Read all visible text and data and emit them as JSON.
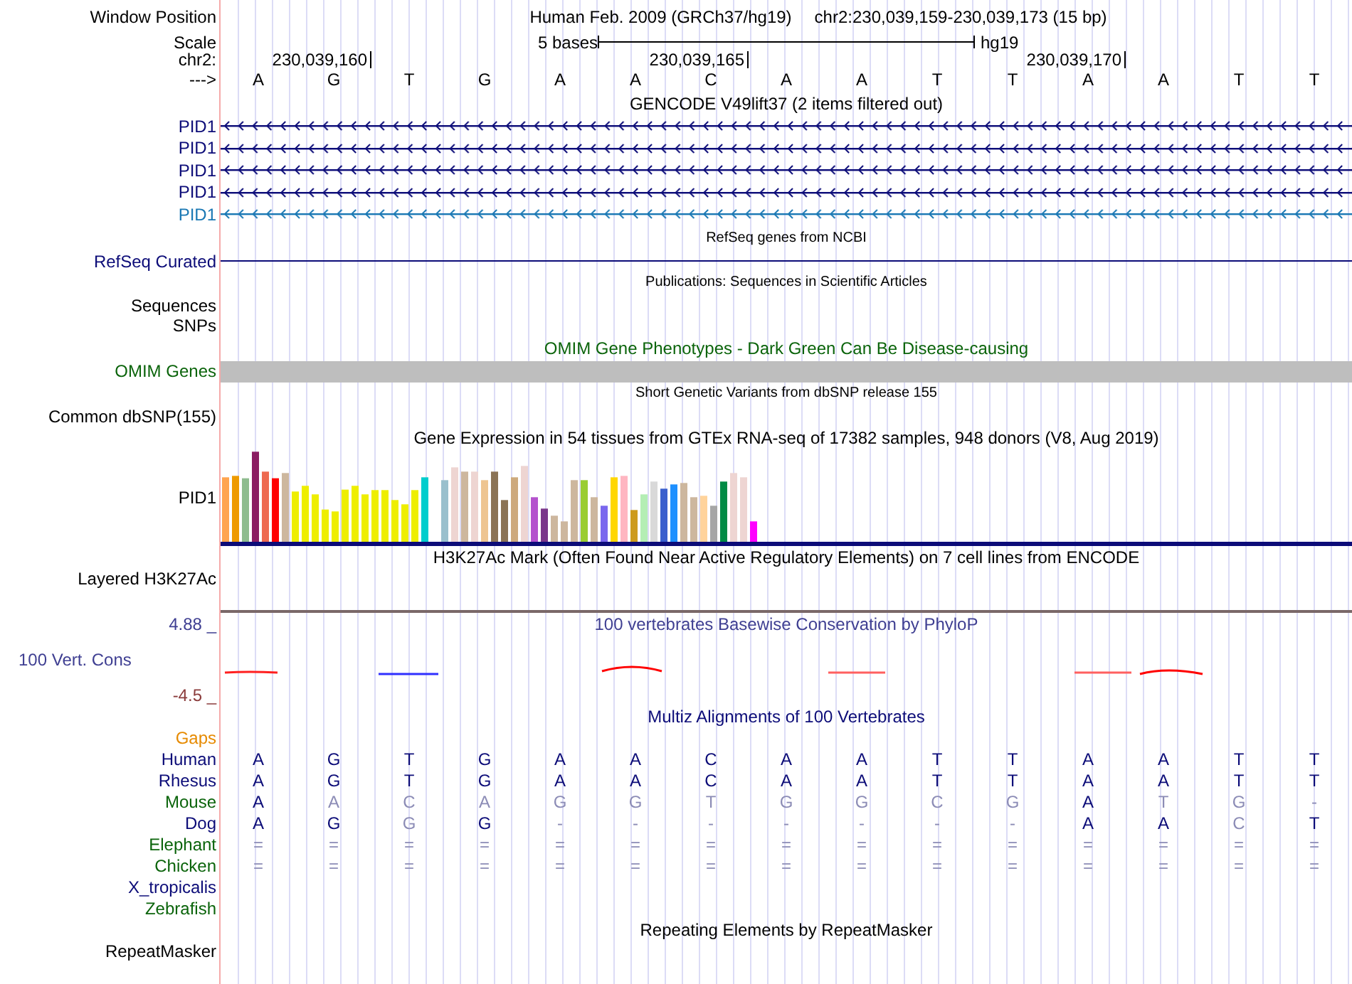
{
  "header": {
    "window_position": {
      "label": "Window Position",
      "assembly": "Human Feb. 2009 (GRCh37/hg19)",
      "region": "chr2:230,039,159-230,039,173 (15 bp)"
    },
    "scale": {
      "label": "Scale",
      "length": "5 bases",
      "assembly": "hg19"
    },
    "ruler_label": "chr2:",
    "strand_label": "--->"
  },
  "sequence": [
    {
      "base": "A"
    },
    {
      "base": "G",
      "coordinate": "230,039,160"
    },
    {
      "base": "T"
    },
    {
      "base": "G"
    },
    {
      "base": "A"
    },
    {
      "base": "A"
    },
    {
      "base": "C",
      "coordinate": "230,039,165"
    },
    {
      "base": "A"
    },
    {
      "base": "A"
    },
    {
      "base": "T"
    },
    {
      "base": "T"
    },
    {
      "base": "A",
      "coordinate": "230,039,170"
    },
    {
      "base": "A"
    },
    {
      "base": "T"
    },
    {
      "base": "T"
    }
  ],
  "gencode": {
    "title": "GENCODE V49lift37 (2 items filtered out)",
    "items": [
      {
        "label": "PID1",
        "color": "#0c0c78"
      },
      {
        "label": "PID1",
        "color": "#0c0c78"
      },
      {
        "label": "PID1",
        "color": "#0c0c78"
      },
      {
        "label": "PID1",
        "color": "#0c0c78"
      },
      {
        "label": "PID1",
        "color": "#1a78b4"
      }
    ]
  },
  "refseq": {
    "title": "RefSeq genes from NCBI",
    "label": "RefSeq Curated"
  },
  "publications": {
    "title": "Publications: Sequences in Scientific Articles",
    "labels": [
      "Sequences",
      "SNPs"
    ]
  },
  "omim": {
    "title": "OMIM Gene Phenotypes - Dark Green Can Be Disease-causing",
    "label": "OMIM Genes"
  },
  "dbsnp": {
    "title": "Short Genetic Variants from dbSNP release 155",
    "label": "Common dbSNP(155)"
  },
  "gtex": {
    "title": "Gene Expression in 54 tissues from GTEx RNA-seq of 17382 samples, 948 donors (V8, Aug 2019)",
    "label": "PID1"
  },
  "h3k27ac": {
    "title": "H3K27Ac Mark (Often Found Near Active Regulatory Elements) on 7 cell lines from ENCODE",
    "label": "Layered H3K27Ac"
  },
  "conservation": {
    "title": "100 vertebrates Basewise Conservation by PhyloP",
    "label": "100 Vert. Cons",
    "max_label": "4.88 _",
    "min_label": "-4.5 _"
  },
  "multiz": {
    "title": "Multiz Alignments of 100 Vertebrates",
    "rows": [
      {
        "name": "Gaps",
        "color": "#e68a00"
      },
      {
        "name": "Human",
        "color": "#0c0c78",
        "bases": [
          "A",
          "G",
          "T",
          "G",
          "A",
          "A",
          "C",
          "A",
          "A",
          "T",
          "T",
          "A",
          "A",
          "T",
          "T"
        ],
        "matches": [
          true,
          true,
          true,
          true,
          true,
          true,
          true,
          true,
          true,
          true,
          true,
          true,
          true,
          true,
          true
        ]
      },
      {
        "name": "Rhesus",
        "color": "#0c0c78",
        "bases": [
          "A",
          "G",
          "T",
          "G",
          "A",
          "A",
          "C",
          "A",
          "A",
          "T",
          "T",
          "A",
          "A",
          "T",
          "T"
        ],
        "matches": [
          true,
          true,
          true,
          true,
          true,
          true,
          true,
          true,
          true,
          true,
          true,
          true,
          true,
          true,
          true
        ]
      },
      {
        "name": "Mouse",
        "color": "#0b640b",
        "bases": [
          "A",
          "A",
          "C",
          "A",
          "G",
          "G",
          "T",
          "G",
          "G",
          "C",
          "G",
          "A",
          "T",
          "G",
          "-"
        ],
        "matches": [
          true,
          false,
          false,
          false,
          false,
          false,
          false,
          false,
          false,
          false,
          false,
          true,
          false,
          false,
          false
        ]
      },
      {
        "name": "Dog",
        "color": "#0c0c78",
        "bases": [
          "A",
          "G",
          "G",
          "G",
          "-",
          "-",
          "-",
          "-",
          "-",
          "-",
          "-",
          "A",
          "A",
          "C",
          "T"
        ],
        "matches": [
          true,
          true,
          false,
          true,
          false,
          false,
          false,
          false,
          false,
          false,
          false,
          true,
          true,
          false,
          true
        ]
      },
      {
        "name": "Elephant",
        "color": "#0b640b",
        "bases": [
          "=",
          "=",
          "=",
          "=",
          "=",
          "=",
          "=",
          "=",
          "=",
          "=",
          "=",
          "=",
          "=",
          "=",
          "="
        ],
        "matches": [
          false,
          false,
          false,
          false,
          false,
          false,
          false,
          false,
          false,
          false,
          false,
          false,
          false,
          false,
          false
        ]
      },
      {
        "name": "Chicken",
        "color": "#0b640b",
        "bases": [
          "=",
          "=",
          "=",
          "=",
          "=",
          "=",
          "=",
          "=",
          "=",
          "=",
          "=",
          "=",
          "=",
          "=",
          "="
        ],
        "matches": [
          false,
          false,
          false,
          false,
          false,
          false,
          false,
          false,
          false,
          false,
          false,
          false,
          false,
          false,
          false
        ]
      },
      {
        "name": "X_tropicalis",
        "color": "#0c0c78"
      },
      {
        "name": "Zebrafish",
        "color": "#0b640b"
      }
    ]
  },
  "repeatmasker": {
    "title": "Repeating Elements by RepeatMasker",
    "label": "RepeatMasker"
  }
}
